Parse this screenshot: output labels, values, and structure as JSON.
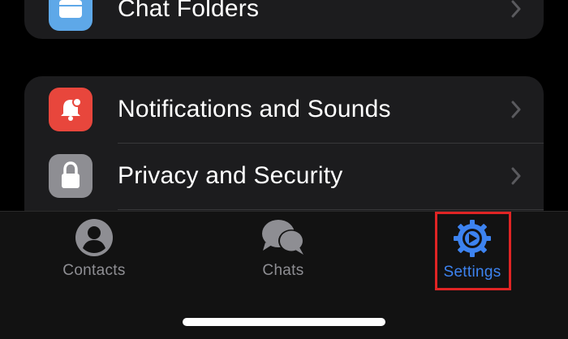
{
  "settings_list": {
    "top_item": {
      "label": "Chat Folders",
      "icon": "folder-icon",
      "icon_color": "#5ea8e8"
    },
    "items": [
      {
        "label": "Notifications and Sounds",
        "icon": "bell-icon",
        "icon_color": "#e8463c"
      },
      {
        "label": "Privacy and Security",
        "icon": "lock-icon",
        "icon_color": "#8e8e93"
      }
    ]
  },
  "tab_bar": {
    "tabs": [
      {
        "label": "Contacts",
        "icon": "person-circle-icon",
        "active": false
      },
      {
        "label": "Chats",
        "icon": "chat-bubbles-icon",
        "active": false
      },
      {
        "label": "Settings",
        "icon": "gear-icon",
        "active": true
      }
    ],
    "active_color": "#3d83f0",
    "inactive_color": "#8e8e93",
    "highlight_color": "#e02424"
  }
}
